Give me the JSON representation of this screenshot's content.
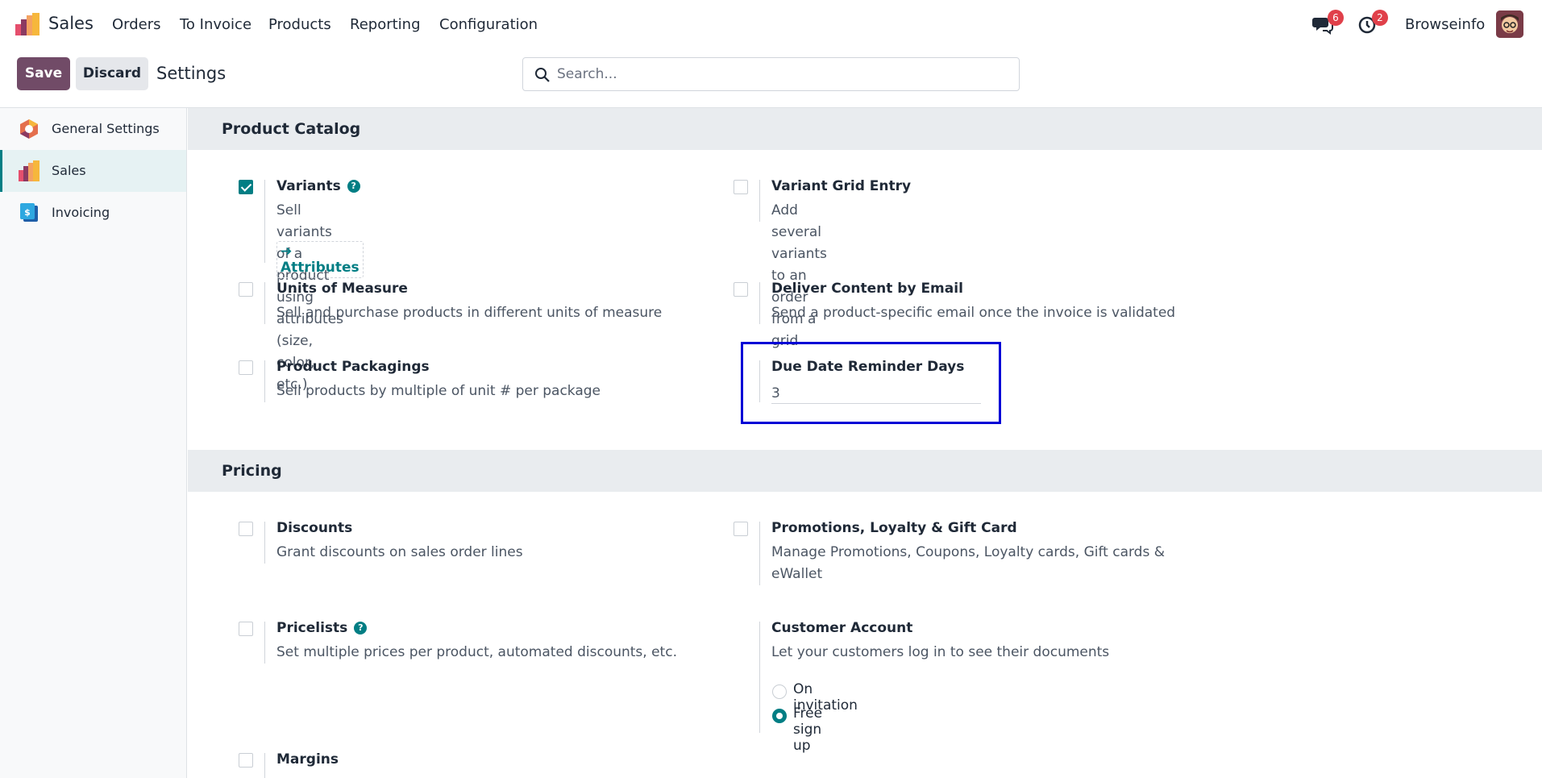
{
  "navbar": {
    "app_name": "Sales",
    "menu": [
      "Orders",
      "To Invoice",
      "Products",
      "Reporting",
      "Configuration"
    ],
    "messages_count": "6",
    "activities_count": "2",
    "user_name": "Browseinfo"
  },
  "control_panel": {
    "save_label": "Save",
    "discard_label": "Discard",
    "breadcrumb": "Settings",
    "search_placeholder": "Search..."
  },
  "sidebar": {
    "items": [
      {
        "label": "General Settings",
        "icon": "general-settings-icon",
        "active": false
      },
      {
        "label": "Sales",
        "icon": "sales-icon",
        "active": true
      },
      {
        "label": "Invoicing",
        "icon": "invoicing-icon",
        "active": false
      }
    ]
  },
  "sections": {
    "catalog": {
      "title": "Product Catalog",
      "variants": {
        "title": "Variants",
        "desc": "Sell variants of a product using attributes (size, color, etc.)",
        "checked": true,
        "link": "Attributes"
      },
      "variant_grid": {
        "title": "Variant Grid Entry",
        "desc": "Add several variants to an order from a grid",
        "checked": false
      },
      "uom": {
        "title": "Units of Measure",
        "desc": "Sell and purchase products in different units of measure",
        "checked": false
      },
      "deliver_content": {
        "title": "Deliver Content by Email",
        "desc": "Send a product-specific email once the invoice is validated",
        "checked": false
      },
      "packagings": {
        "title": "Product Packagings",
        "desc": "Sell products by multiple of unit # per package",
        "checked": false
      },
      "due_date": {
        "title": "Due Date Reminder Days",
        "value": "3"
      }
    },
    "pricing": {
      "title": "Pricing",
      "discounts": {
        "title": "Discounts",
        "desc": "Grant discounts on sales order lines",
        "checked": false
      },
      "promotions": {
        "title": "Promotions, Loyalty & Gift Card",
        "desc_line1": "Manage Promotions, Coupons, Loyalty cards, Gift cards &",
        "desc_line2": "eWallet",
        "checked": false
      },
      "pricelists": {
        "title": "Pricelists",
        "desc": "Set multiple prices per product, automated discounts, etc.",
        "checked": false
      },
      "customer_account": {
        "title": "Customer Account",
        "desc": "Let your customers log in to see their documents",
        "options": [
          {
            "label": "On invitation",
            "selected": false
          },
          {
            "label": "Free sign up",
            "selected": true
          }
        ]
      },
      "margins": {
        "title": "Margins",
        "checked": false
      }
    }
  },
  "colors": {
    "brand": "#714b67",
    "accent": "#017e84",
    "highlight": "#0000d6",
    "badge": "#e0404a"
  }
}
